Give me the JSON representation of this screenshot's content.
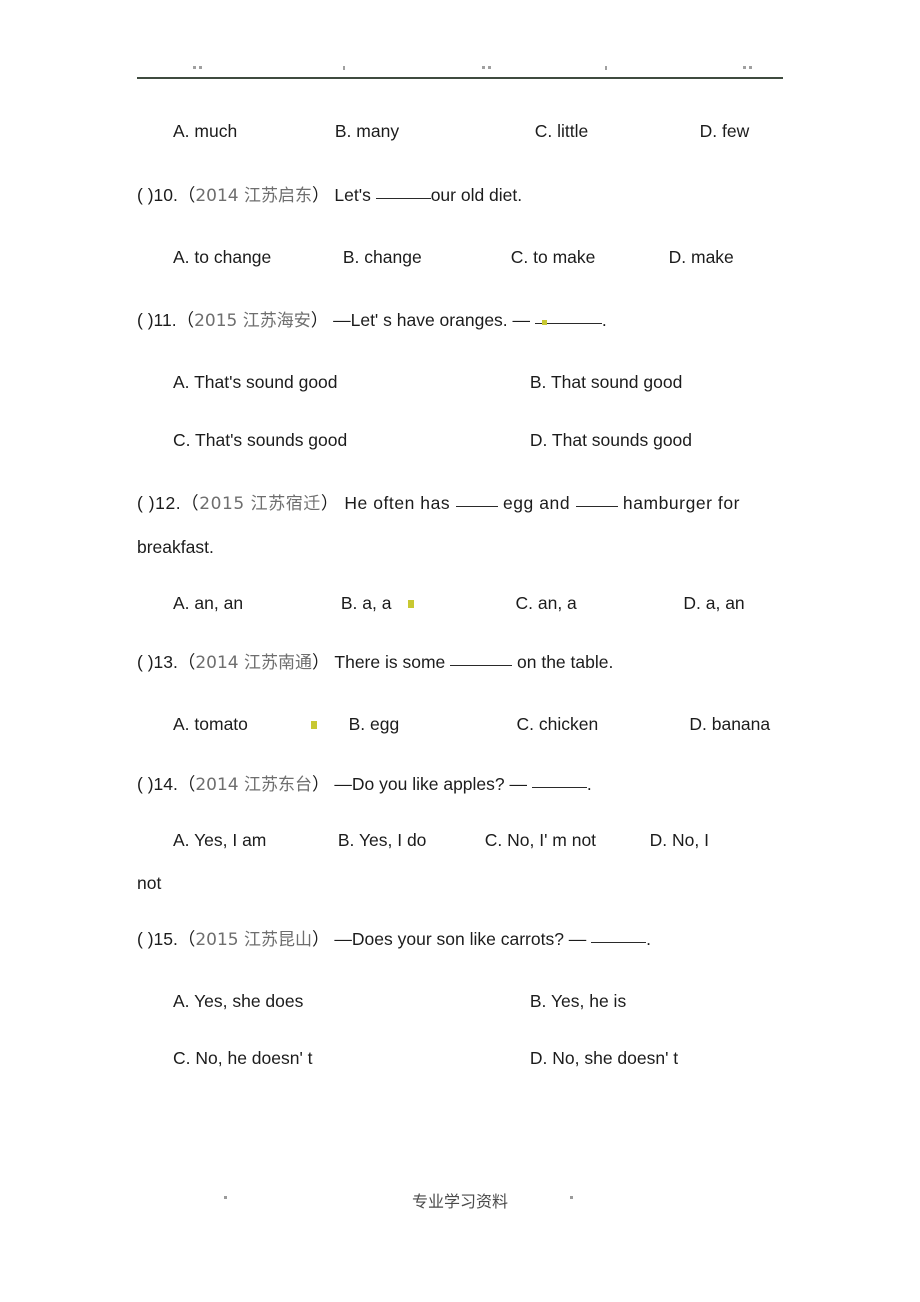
{
  "page": {
    "footer_text": "专业学习资料",
    "header_rule_color": "#3f4b3f",
    "chinese_label_color": "#6e6e6e",
    "highlight_mark_color": "#c8c832"
  },
  "questions": [
    {
      "id": "q9-options",
      "options_only": true,
      "options": [
        {
          "label": "A. much"
        },
        {
          "label": "B. many"
        },
        {
          "label": "C. little"
        },
        {
          "label": "D. few"
        }
      ]
    },
    {
      "id": "q10",
      "bracket": "(  )",
      "number": "10.",
      "source_open": "（",
      "year": "2014 ",
      "place": "江苏启东",
      "source_close": "）",
      "stem_before": "Let's ",
      "stem_after": "our old diet.",
      "options": [
        {
          "label": "A. to change"
        },
        {
          "label": "B. change"
        },
        {
          "label": "C. to make"
        },
        {
          "label": "D. make"
        }
      ]
    },
    {
      "id": "q11",
      "bracket": "(  )",
      "number": "11.",
      "source_open": "（",
      "year": "2015 ",
      "place": "江苏海安",
      "source_close": "）",
      "stem_before": "—Let' s have oranges. — ",
      "stem_after": ".",
      "options": [
        {
          "label": "A. That's sound good"
        },
        {
          "label": "B. That sound good"
        },
        {
          "label": "C. That's sounds good"
        },
        {
          "label": "D. That sounds good"
        }
      ]
    },
    {
      "id": "q12",
      "bracket": "(  )",
      "number": "12.",
      "source_open": "（",
      "year": "2015 ",
      "place": "江苏宿迁",
      "source_close": "）",
      "stem_part1": "He often has ",
      "stem_part2": " egg and ",
      "stem_part3": " hamburger for",
      "stem_wrapped": "breakfast.",
      "options": [
        {
          "label": "A. an, an"
        },
        {
          "label": "B. a, a"
        },
        {
          "label": "C. an, a"
        },
        {
          "label": "D. a, an"
        }
      ]
    },
    {
      "id": "q13",
      "bracket": "(  )",
      "number": "13.",
      "source_open": "（",
      "year": "2014 ",
      "place": "江苏南通",
      "source_close": "）",
      "stem_before": "There is some ",
      "stem_after": " on the table.",
      "options": [
        {
          "label": "A. tomato"
        },
        {
          "label": "B. egg"
        },
        {
          "label": "C. chicken"
        },
        {
          "label": "D. banana"
        }
      ]
    },
    {
      "id": "q14",
      "bracket": "(  )",
      "number": "14.",
      "source_open": "（",
      "year": "2014 ",
      "place": "江苏东台",
      "source_close": "）",
      "stem_before": "—Do you like apples? — ",
      "stem_after": ".",
      "options": [
        {
          "label": "A. Yes, I am"
        },
        {
          "label": "B. Yes, I do"
        },
        {
          "label": "C. No, I' m not"
        },
        {
          "label": "D.   No,  I"
        }
      ],
      "options_wrapped": "not"
    },
    {
      "id": "q15",
      "bracket": "(  )",
      "number": "15.",
      "source_open": "（",
      "year": "2015 ",
      "place": "江苏昆山",
      "source_close": "）",
      "stem_before": "—Does your son like carrots? — ",
      "stem_after": ".",
      "options": [
        {
          "label": "A. Yes, she does"
        },
        {
          "label": "B. Yes, he is"
        },
        {
          "label": "C. No, he doesn' t"
        },
        {
          "label": "D. No, she doesn' t"
        }
      ]
    }
  ]
}
